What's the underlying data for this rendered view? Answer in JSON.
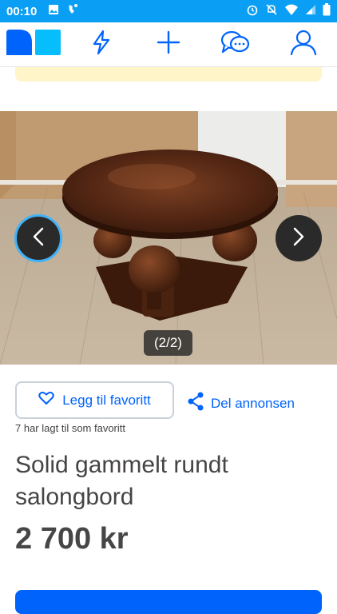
{
  "status_bar": {
    "time": "00:10",
    "icons_left": [
      "image-icon",
      "phone-tap-icon"
    ],
    "icons_right": [
      "alarm-icon",
      "mute-icon",
      "wifi-icon",
      "signal-icon",
      "battery-icon"
    ]
  },
  "app_bar": {
    "items": [
      {
        "name": "finn-logo-icon"
      },
      {
        "name": "lightning-icon"
      },
      {
        "name": "plus-icon"
      },
      {
        "name": "messages-icon"
      },
      {
        "name": "profile-icon"
      }
    ],
    "accent": "#0063fb",
    "logo_light": "#06befb"
  },
  "gallery": {
    "counter": "(2/2)",
    "prev_icon": "chevron-left-icon",
    "next_icon": "chevron-right-icon"
  },
  "actions": {
    "favorite_label": "Legg til favoritt",
    "share_label": "Del annonsen",
    "favorite_count_text": "7 har lagt til som favoritt"
  },
  "listing": {
    "title": "Solid gammelt rundt salongbord",
    "price": "2 700 kr"
  }
}
